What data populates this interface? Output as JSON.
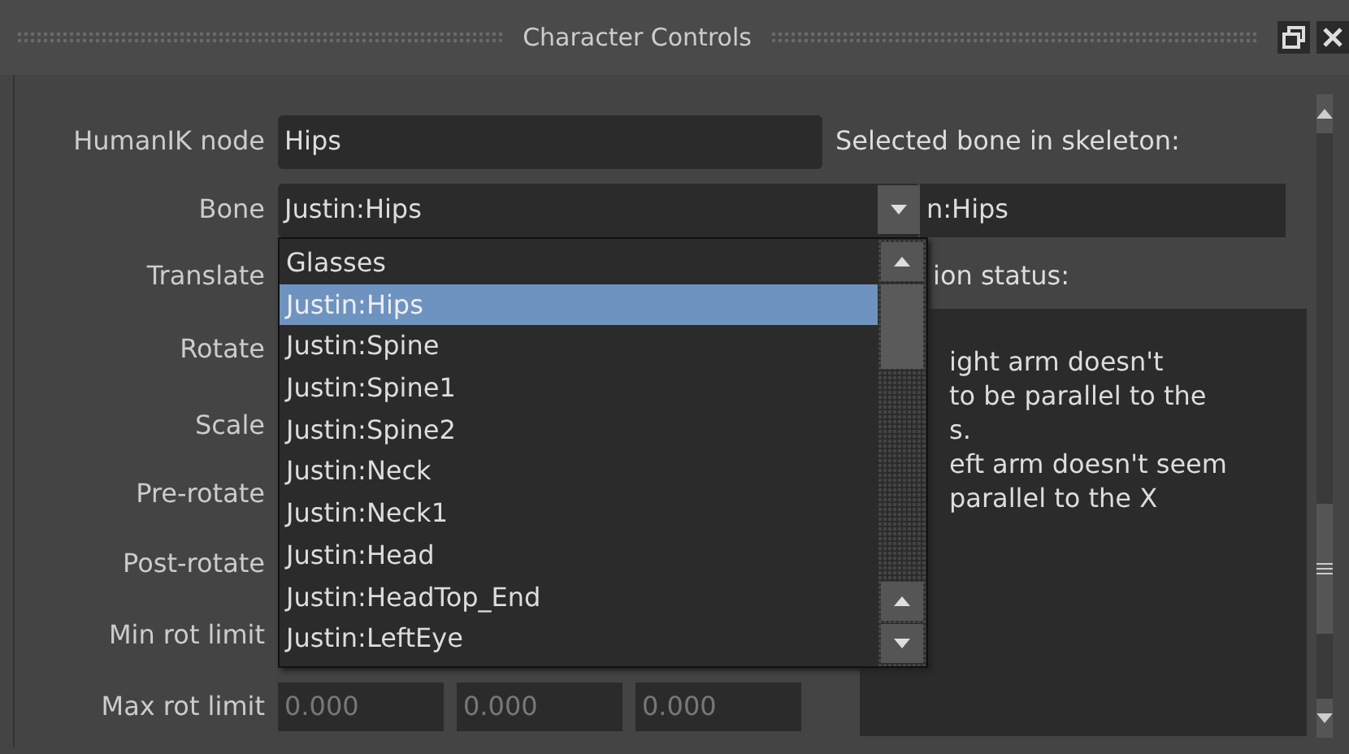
{
  "window": {
    "title": "Character Controls"
  },
  "form": {
    "humanik_node": {
      "label": "HumanIK node",
      "value": "Hips"
    },
    "bone": {
      "label": "Bone",
      "value": "Justin:Hips"
    },
    "row_labels": [
      "Translate",
      "Rotate",
      "Scale",
      "Pre-rotate",
      "Post-rotate",
      "Min rot limit"
    ],
    "max_rot_limit": {
      "label": "Max rot limit",
      "values": [
        "0.000",
        "0.000",
        "0.000"
      ],
      "disabled": true
    }
  },
  "selected_bone": {
    "label": "Selected bone in skeleton:",
    "value": "n:Hips"
  },
  "status": {
    "label": "ion status:",
    "lines": [
      "ight arm doesn't",
      "to be parallel to the",
      "s.",
      "eft arm doesn't seem",
      "parallel to the X"
    ]
  },
  "dropdown": {
    "items": [
      {
        "label": "Glasses",
        "selected": false
      },
      {
        "label": "Justin:Hips",
        "selected": true
      },
      {
        "label": "Justin:Spine",
        "selected": false
      },
      {
        "label": "Justin:Spine1",
        "selected": false
      },
      {
        "label": "Justin:Spine2",
        "selected": false
      },
      {
        "label": "Justin:Neck",
        "selected": false
      },
      {
        "label": "Justin:Neck1",
        "selected": false
      },
      {
        "label": "Justin:Head",
        "selected": false
      },
      {
        "label": "Justin:HeadTop_End",
        "selected": false
      },
      {
        "label": "Justin:LeftEye",
        "selected": false
      }
    ]
  }
}
